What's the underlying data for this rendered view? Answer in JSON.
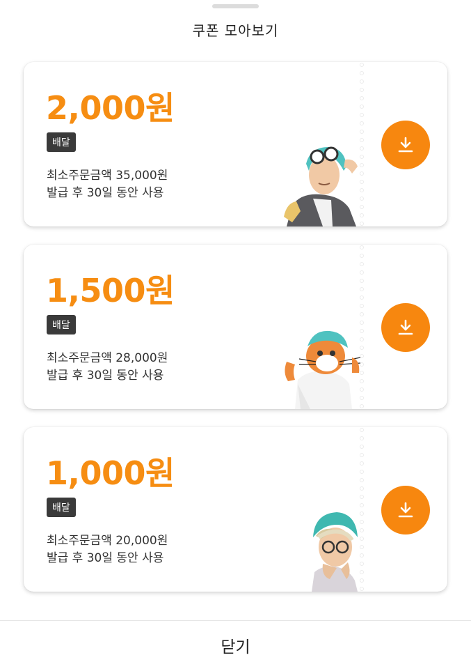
{
  "sheet": {
    "title": "쿠폰 모아보기"
  },
  "coupons": [
    {
      "amount": "2,000원",
      "tag": "배달",
      "min_order": "최소주문금액 35,000원",
      "validity": "발급 후 30일 동안 사용",
      "character": "pilot-man-illustration"
    },
    {
      "amount": "1,500원",
      "tag": "배달",
      "min_order": "최소주문금액 28,000원",
      "validity": "발급 후 30일 동안 사용",
      "character": "cat-helmet-illustration"
    },
    {
      "amount": "1,000원",
      "tag": "배달",
      "min_order": "최소주문금액 20,000원",
      "validity": "발급 후 30일 동안 사용",
      "character": "grandma-helmet-illustration"
    }
  ],
  "download_icon": "download-icon",
  "colors": {
    "accent": "#f7870f",
    "amount": "#f68d12",
    "tag_bg": "#3a3a3a"
  },
  "footer": {
    "close_label": "닫기"
  }
}
